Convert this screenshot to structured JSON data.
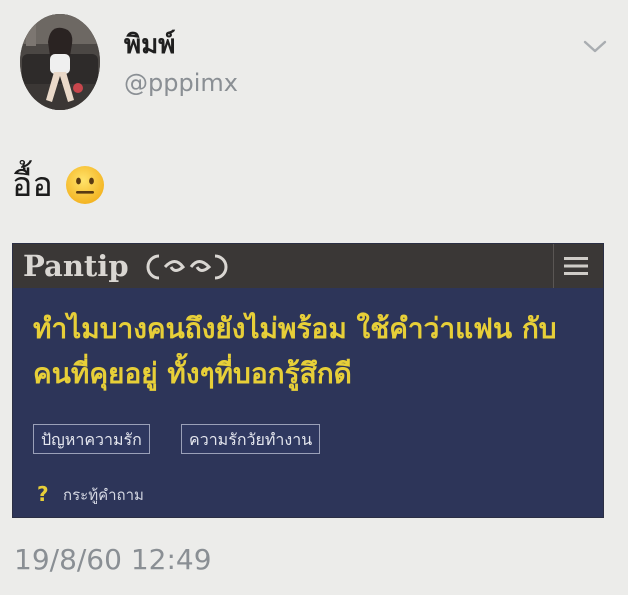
{
  "user": {
    "display_name": "พิมพ์",
    "handle": "@pppimx"
  },
  "tweet": {
    "text": "อื้อ",
    "emoji": "neutral-face-emoji"
  },
  "card": {
    "brand": "Pantip",
    "title": "ทำไมบางคนถึงยังไม่พร้อม ใช้คำว่าแฟน กับคนที่คุยอยู่ ทั้งๆที่บอกรู้สึกดี",
    "tags": [
      "ปัญหาความรัก",
      "ความรักวัยทำงาน"
    ],
    "type_label": "กระทู้คำถาม",
    "type_icon": "?"
  },
  "timestamp": "19/8/60 12:49",
  "colors": {
    "accent_yellow": "#e7cf38",
    "card_background": "#2d3559",
    "card_header": "#3a3736",
    "muted_text": "#8a8f94"
  }
}
